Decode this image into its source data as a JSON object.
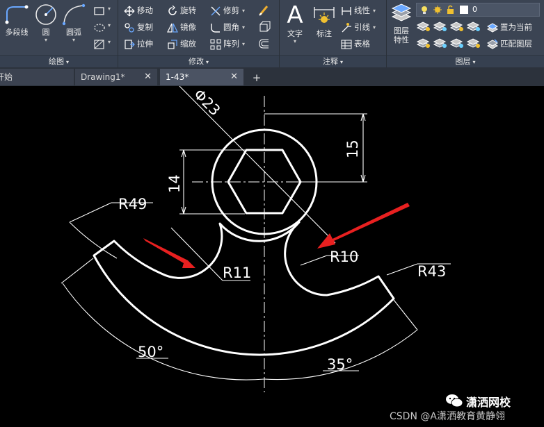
{
  "ribbon": {
    "draw": {
      "title": "绘图",
      "polyline": "多段线",
      "circle": "圆",
      "arc": "圆弧"
    },
    "modify": {
      "title": "修改",
      "move": "移动",
      "rotate": "旋转",
      "trim": "修剪",
      "copy": "复制",
      "mirror": "镜像",
      "fillet": "圆角",
      "stretch": "拉伸",
      "scale": "缩放",
      "array": "阵列"
    },
    "annotation": {
      "title": "注释",
      "text": "文字",
      "dimension": "标注",
      "linear": "线性",
      "leader": "引线",
      "table": "表格"
    },
    "layers": {
      "title": "图层",
      "layer_properties_l1": "图层",
      "layer_properties_l2": "特性",
      "current_layer": "0",
      "set_current": "置为当前",
      "match_layer": "匹配图层"
    }
  },
  "tabs": [
    {
      "label": "开始"
    },
    {
      "label": "Drawing1*"
    },
    {
      "label": "1-43*"
    }
  ],
  "drawing": {
    "dimensions": {
      "dia": "Φ23",
      "height_15": "15",
      "width_14": "14",
      "r49": "R49",
      "r11": "R11",
      "r10": "R10",
      "r43": "R43",
      "a50": "50°",
      "a35": "35°"
    }
  },
  "watermark": {
    "brand": "潇洒网校",
    "credit": "CSDN @A潇洒教育黄静翎"
  },
  "colors": {
    "ribbon": "#3b4453",
    "canvas": "#000000",
    "line": "#ffffff",
    "arrow": "#e82020"
  }
}
